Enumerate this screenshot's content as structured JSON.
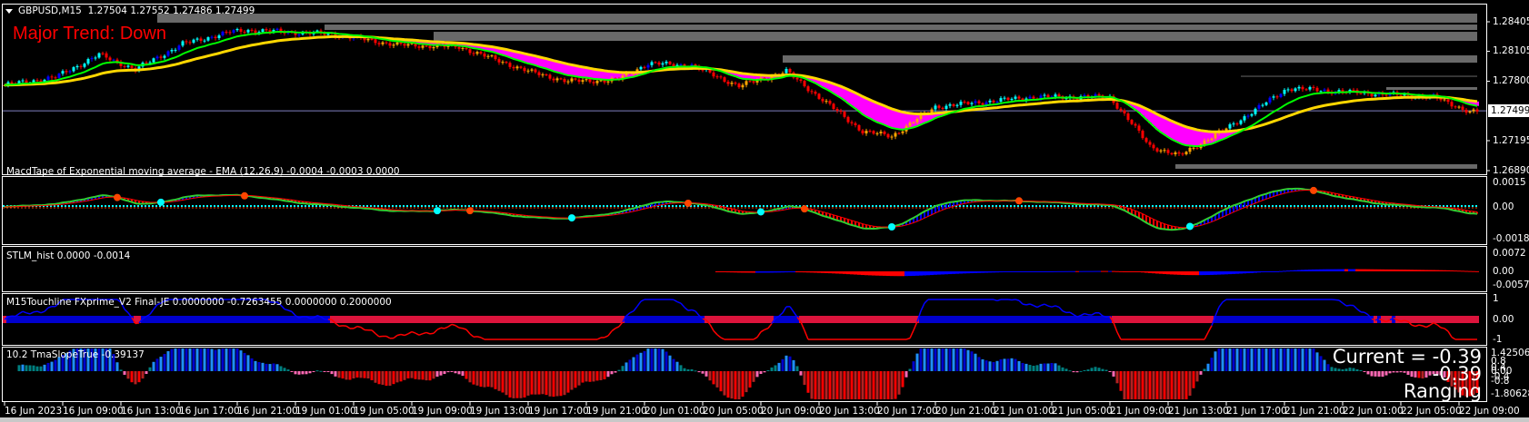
{
  "header": {
    "symbol": "GBPUSD,M15",
    "ohlc": "1.27504 1.27552 1.27486 1.27499"
  },
  "trend_label": "Major Trend: Down",
  "price_axis": {
    "labels": [
      "1.28405",
      "1.28105",
      "1.27800",
      "1.27195",
      "1.26890"
    ],
    "values": [
      1.28405,
      1.28105,
      1.278,
      1.27195,
      1.2689
    ],
    "current": "1.27499",
    "current_value": 1.27499
  },
  "panels": {
    "macd": {
      "title": "MacdTape of Exponential moving average - EMA (12,26,9) -0.0004 -0.0003 0.0000",
      "axis": [
        "0.0015",
        "0.00",
        "-0.0018"
      ]
    },
    "stlm": {
      "title": "STLM_hist 0.0000 -0.0014",
      "axis": [
        "0.0072",
        "0.00",
        "-0.0057"
      ]
    },
    "touchline": {
      "title": "M15Touchline  FXprime_V2 Final-JE 0.0000000 -0.7263455 0.0000000 0.2000000",
      "axis": [
        "1",
        "0.00",
        "-1"
      ]
    },
    "tma": {
      "title": "10.2 TmaSlopeTrue -0.39137",
      "axis": [
        "1.42506",
        "0.8",
        "0.4",
        "0.00",
        "-0.4",
        "-0.8",
        "-1.80628"
      ],
      "current_text": "Current = -0.39",
      "value_text": "-0.39",
      "state_text": "Ranging"
    }
  },
  "time_axis": [
    "16 Jun 2023",
    "16 Jun 09:00",
    "16 Jun 13:00",
    "16 Jun 17:00",
    "16 Jun 21:00",
    "19 Jun 01:00",
    "19 Jun 05:00",
    "19 Jun 09:00",
    "19 Jun 13:00",
    "19 Jun 17:00",
    "19 Jun 21:00",
    "20 Jun 01:00",
    "20 Jun 05:00",
    "20 Jun 09:00",
    "20 Jun 13:00",
    "20 Jun 17:00",
    "20 Jun 21:00",
    "21 Jun 01:00",
    "21 Jun 05:00",
    "21 Jun 09:00",
    "21 Jun 13:00",
    "21 Jun 17:00",
    "21 Jun 21:00",
    "22 Jun 01:00",
    "22 Jun 05:00",
    "22 Jun 09:00"
  ],
  "price_path": [
    [
      0,
      1.2776
    ],
    [
      14,
      1.2784
    ],
    [
      26,
      1.2807
    ],
    [
      36,
      1.2792
    ],
    [
      49,
      1.2818
    ],
    [
      62,
      1.283
    ],
    [
      67,
      1.2832
    ],
    [
      90,
      1.2828
    ],
    [
      108,
      1.2817
    ],
    [
      125,
      1.2815
    ],
    [
      145,
      1.2789
    ],
    [
      155,
      1.278
    ],
    [
      168,
      1.2781
    ],
    [
      177,
      1.2798
    ],
    [
      189,
      1.2796
    ],
    [
      202,
      1.2775
    ],
    [
      215,
      1.279
    ],
    [
      225,
      1.2761
    ],
    [
      236,
      1.2729
    ],
    [
      244,
      1.2724
    ],
    [
      256,
      1.2754
    ],
    [
      283,
      1.2764
    ],
    [
      304,
      1.2764
    ],
    [
      315,
      1.2714
    ],
    [
      323,
      1.2704
    ],
    [
      337,
      1.2734
    ],
    [
      353,
      1.2773
    ],
    [
      374,
      1.2768
    ],
    [
      393,
      1.2764
    ],
    [
      403,
      1.2749
    ]
  ],
  "zones": [
    {
      "from_bar": 42,
      "top": 1.28488,
      "bottom": 1.28396
    },
    {
      "from_bar": 88,
      "top": 1.28377,
      "bottom": 1.28322
    },
    {
      "from_bar": 118,
      "top": 1.28303,
      "bottom": 1.28211
    },
    {
      "from_bar": 214,
      "top": 1.28063,
      "bottom": 1.27989
    },
    {
      "from_bar": 340,
      "top": 1.27855,
      "bottom": 1.27848
    },
    {
      "from_bar": 380,
      "top": 1.2774,
      "bottom": 1.27712
    },
    {
      "from_bar": 322,
      "top": 1.26955,
      "bottom": 1.26909
    }
  ],
  "colors": {
    "up": "#0000ff",
    "up2": "#00ffff",
    "down": "#ff0000",
    "ma_slow": "#ffd700",
    "ma_fast": "#00ff00",
    "fill": "#ff00ff",
    "zone": "#696969",
    "crimson": "#dc143c",
    "pink": "#ff69b4",
    "teal": "#008080",
    "dodger": "#1e90ff",
    "firebrick": "#b22222"
  }
}
